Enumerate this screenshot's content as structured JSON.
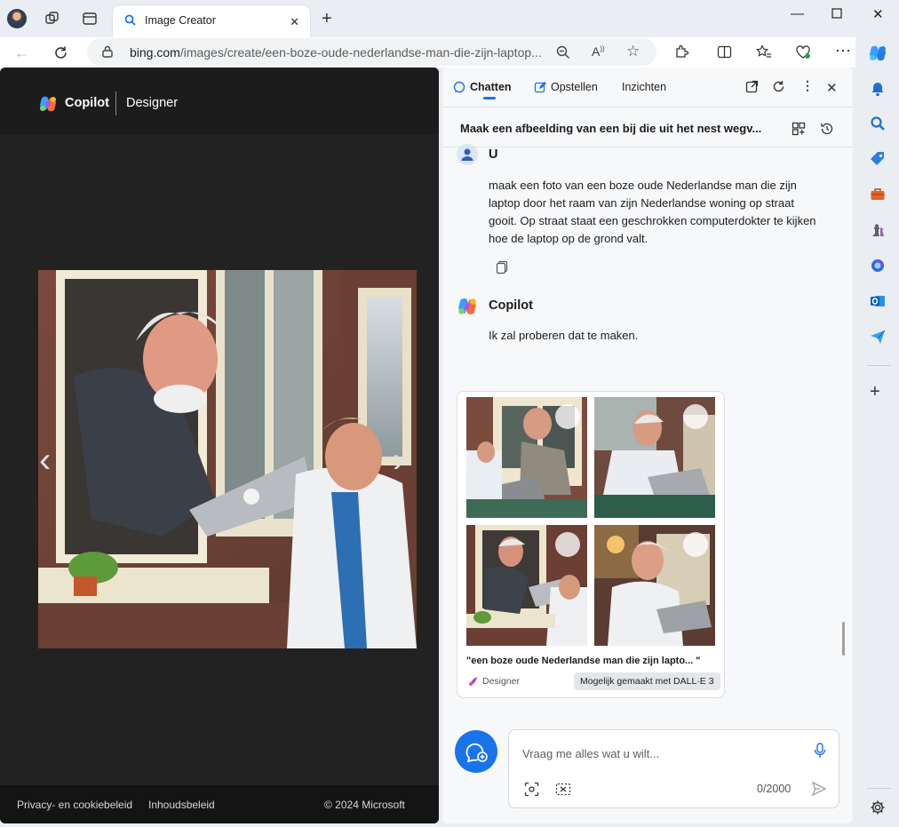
{
  "browser": {
    "tab_title": "Image Creator",
    "url_domain": "bing.com",
    "url_path": "/images/create/een-boze-oude-nederlandse-man-die-zijn-laptop..."
  },
  "designer": {
    "brand": "Copilot",
    "product": "Designer",
    "footer": {
      "privacy": "Privacy- en cookiebeleid",
      "content_policy": "Inhoudsbeleid",
      "copyright": "© 2024 Microsoft"
    }
  },
  "sidebar": {
    "tabs": [
      "Chatten",
      "Opstellen",
      "Inzichten"
    ],
    "conversation_title": "Maak een afbeelding van een bij die uit het nest wegv...",
    "user": {
      "name": "U",
      "message": "maak een foto van een boze oude Nederlandse man die zijn laptop door het raam van zijn Nederlandse woning op straat gooit. Op straat staat een geschrokken computerdokter te kijken hoe de laptop op de grond valt."
    },
    "assistant": {
      "name": "Copilot",
      "message": "Ik zal proberen dat te maken."
    },
    "image_card": {
      "caption": "\"een boze oude Nederlandse man die zijn lapto... \"",
      "source": "Designer",
      "attribution": "Mogelijk gemaakt met DALL·E 3"
    },
    "input": {
      "placeholder": "Vraag me alles wat u wilt...",
      "counter": "0/2000"
    }
  },
  "colors": {
    "accent": "#1a73e8",
    "panel_dark": "#232222"
  },
  "icons": [
    "search-icon",
    "copilot-icon",
    "bell-icon",
    "tag-icon",
    "briefcase-icon",
    "chess-icon",
    "m365-icon",
    "outlook-icon",
    "send-icon",
    "plus-icon",
    "settings-icon"
  ]
}
